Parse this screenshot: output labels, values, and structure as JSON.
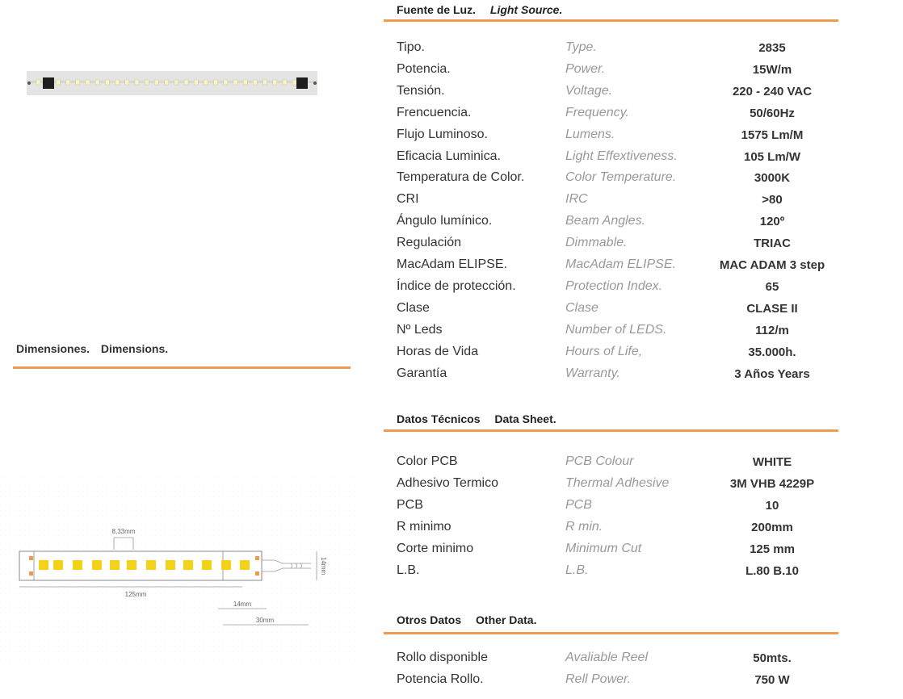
{
  "light_source": {
    "title_es": "Fuente de Luz.",
    "title_en": "Light Source.",
    "rows": [
      {
        "es": "Tipo.",
        "en": "Type.",
        "value": "2835"
      },
      {
        "es": "Potencia.",
        "en": "Power.",
        "value": "15W/m"
      },
      {
        "es": "Tensión.",
        "en": "Voltage.",
        "value": "220 - 240 VAC"
      },
      {
        "es": "Frencuencia.",
        "en": "Frequency.",
        "value": "50/60Hz"
      },
      {
        "es": "Flujo Luminoso.",
        "en": "Lumens.",
        "value": "1575 Lm/M"
      },
      {
        "es": "Eficacia Luminica.",
        "en": "Light Effextiveness.",
        "value": "105 Lm/W"
      },
      {
        "es": "Temperatura de Color.",
        "en": "Color Temperature.",
        "value": "3000K"
      },
      {
        "es": "CRI",
        "en": "IRC",
        "value": ">80"
      },
      {
        "es": "Ángulo lumínico.",
        "en": "Beam Angles.",
        "value": "120º"
      },
      {
        "es": "Regulación",
        "en": "Dimmable.",
        "value": "TRIAC"
      },
      {
        "es": "MacAdam ELIPSE.",
        "en": "MacAdam ELIPSE.",
        "value": "MAC ADAM 3 step"
      },
      {
        "es": "Índice de protección.",
        "en": "Protection Index.",
        "value": "65"
      },
      {
        "es": "Clase",
        "en": "Clase",
        "value": "CLASE II"
      },
      {
        "es": "Nº Leds",
        "en": "Number of LEDS.",
        "value": "112/m"
      },
      {
        "es": "Horas de Vida",
        "en": "Hours of Life,",
        "value": "35.000h."
      },
      {
        "es": "Garantía",
        "en": "Warranty.",
        "value": "3 Años   Years"
      }
    ]
  },
  "data_sheet": {
    "title_es": "Datos Técnicos",
    "title_en": "Data Sheet.",
    "rows": [
      {
        "es": "Color PCB",
        "en": "PCB Colour",
        "value": "WHITE"
      },
      {
        "es": "Adhesivo Termico",
        "en": "Thermal Adhesive",
        "value": "3M VHB 4229P"
      },
      {
        "es": "PCB",
        "en": "PCB",
        "value": "10"
      },
      {
        "es": "R minimo",
        "en": "R min.",
        "value": "200mm"
      },
      {
        "es": "Corte minimo",
        "en": "Minimum Cut",
        "value": "125 mm"
      },
      {
        "es": "L.B.",
        "en": "L.B.",
        "value": "L.80 B.10"
      }
    ]
  },
  "other_data": {
    "title_es": "Otros Datos",
    "title_en": "Other Data.",
    "rows": [
      {
        "es": "Rollo disponible",
        "en": "Avaliable Reel",
        "value": "50mts."
      },
      {
        "es": "Potencia Rollo.",
        "en": "Rell Power.",
        "value": "750 W"
      }
    ]
  },
  "dimensions": {
    "title_es": "Dimensiones.",
    "title_en": "Dimensions.",
    "pitch_label": "8,33mm",
    "cut_label": "125mm",
    "width_label": "14mm",
    "bottom_label_1": "14mm",
    "bottom_label_2": "30mm"
  },
  "colors": {
    "accent": "#ef9b4f",
    "led": "#f5d21a"
  }
}
